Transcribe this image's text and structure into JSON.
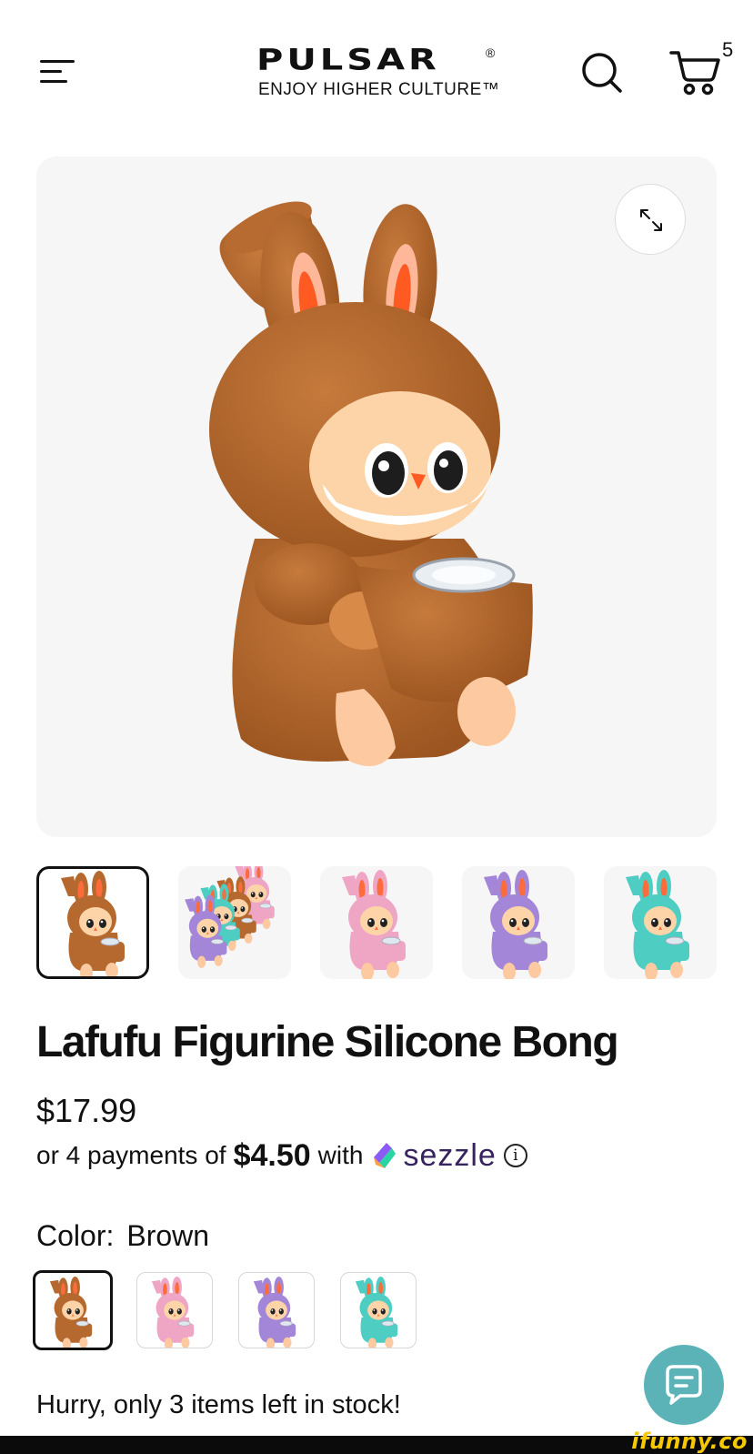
{
  "header": {
    "brand": "PULSAR",
    "brand_mark": "®",
    "tagline": "ENJOY HIGHER CULTURE™",
    "menu_icon": "hamburger-menu-icon",
    "search_icon": "search-icon",
    "cart_icon": "cart-icon",
    "cart_count": "5"
  },
  "gallery": {
    "zoom_icon": "expand-icon",
    "thumbnails": [
      {
        "label": "brown",
        "active": true
      },
      {
        "label": "group",
        "active": false
      },
      {
        "label": "pink",
        "active": false
      },
      {
        "label": "purple",
        "active": false
      },
      {
        "label": "teal",
        "active": false
      }
    ]
  },
  "product": {
    "title": "Lafufu Figurine Silicone Bong",
    "price": "$17.99",
    "payments_prefix": "or 4 payments of",
    "payments_amount": "$4.50",
    "payments_with": "with",
    "provider": "sezzle",
    "info_glyph": "i",
    "color_label": "Color:",
    "color_value": "Brown",
    "stock_message": "Hurry, only 3 items left in stock!"
  },
  "colors": {
    "brown": "#b5692e",
    "pink": "#efa6c4",
    "purple": "#a486d8",
    "teal": "#4ecdc3",
    "chat": "#5bb3b7",
    "sezzle": "#37235f"
  },
  "watermark": "ifunny.co"
}
